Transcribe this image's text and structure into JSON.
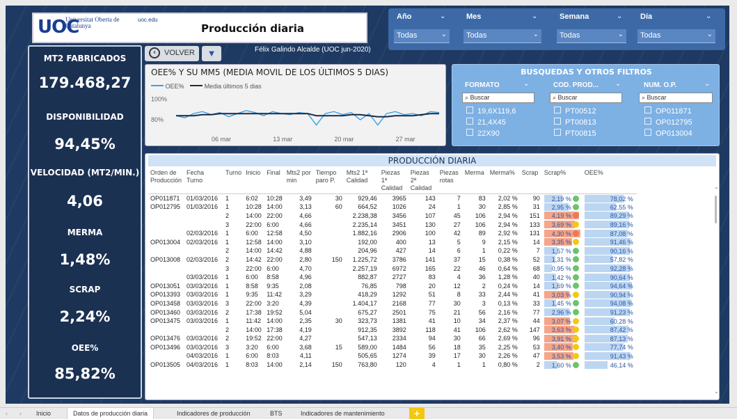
{
  "logo": {
    "text": "UOC",
    "university": "Universitat Oberta de Catalunya",
    "url": "uoc.edu"
  },
  "page_title": "Producción diaria",
  "slicers": [
    {
      "label": "Año",
      "value": "Todas"
    },
    {
      "label": "Mes",
      "value": "Todas"
    },
    {
      "label": "Semana",
      "value": "Todas"
    },
    {
      "label": "Día",
      "value": "Todas"
    }
  ],
  "kpis": [
    {
      "label": "MT2 FABRICADOS",
      "value": "179.468,27"
    },
    {
      "label": "DISPONIBILIDAD",
      "value": "94,45%"
    },
    {
      "label": "VELOCIDAD (MT2/MIN.)",
      "value": "4,06"
    },
    {
      "label": "MERMA",
      "value": "1,48%"
    },
    {
      "label": "SCRAP",
      "value": "2,24%"
    },
    {
      "label": "OEE%",
      "value": "85,82%"
    }
  ],
  "toolbar": {
    "back_label": "VOLVER",
    "author": "Félix Galindo Alcalde (UOC jun-2020)"
  },
  "oee_chart": {
    "title": "OEE% Y SU MM5 (MEDIA MOVIL DE LOS ÚLTIMOS 5 DIAS)",
    "legend": [
      "OEE%",
      "Media últimos 5 dias"
    ],
    "colors": {
      "oee": "#3aa0e8",
      "avg": "#1b2a44"
    },
    "y_ticks": [
      "100%",
      "80%"
    ],
    "x_ticks": [
      "06 mar",
      "13 mar",
      "20 mar",
      "27 mar"
    ]
  },
  "chart_data": {
    "type": "line",
    "x": [
      1,
      2,
      3,
      4,
      5,
      6,
      7,
      8,
      9,
      10,
      11,
      12,
      13,
      14,
      15,
      16,
      17,
      18,
      19,
      20,
      21,
      22,
      23,
      24,
      25,
      26,
      27,
      28,
      29,
      30,
      31
    ],
    "series": [
      {
        "name": "OEE%",
        "values": [
          84,
          82,
          86,
          88,
          85,
          87,
          83,
          86,
          89,
          87,
          84,
          88,
          86,
          85,
          87,
          86,
          75,
          86,
          88,
          85,
          87,
          80,
          86,
          75,
          86,
          88,
          85,
          86,
          84,
          88,
          87
        ]
      },
      {
        "name": "Media últimos 5 dias",
        "values": [
          84,
          84,
          84,
          85,
          85,
          86,
          86,
          86,
          86,
          86,
          86,
          86,
          86,
          86,
          86,
          86,
          84,
          84,
          84,
          84,
          85,
          85,
          84,
          83,
          83,
          84,
          84,
          84,
          85,
          86,
          86
        ]
      }
    ],
    "ylim": [
      70,
      105
    ],
    "xlabels": [
      "06 mar",
      "13 mar",
      "20 mar",
      "27 mar"
    ],
    "ylabels": [
      "100%",
      "80%"
    ]
  },
  "filters": {
    "title": "BUSQUEDAS Y OTROS FILTROS",
    "search_placeholder": "Buscar",
    "columns": [
      {
        "header": "FORMATO",
        "items": [
          "19,6X119,6",
          "21,4X45",
          "22X90"
        ]
      },
      {
        "header": "COD. PROD...",
        "items": [
          "PT00512",
          "PT00813",
          "PT00815"
        ]
      },
      {
        "header": "NUM. O.P.",
        "items": [
          "OP011871",
          "OP012795",
          "OP013004"
        ]
      }
    ]
  },
  "table": {
    "title": "PRODUCCIÓN DIARIA",
    "headers": [
      "Orden de Producción",
      "Fecha Turno",
      "Turno",
      "Inicio",
      "Final",
      "Mts2 por min",
      "Tiempo paro P.",
      "Mts2 1ª Calidad",
      "Piezas 1ª Calidad",
      "Piezas 2ª Calidad",
      "Piezas rotas",
      "Merma",
      "Merma%",
      "Scrap",
      "Scrap%",
      "OEE%"
    ],
    "rows": [
      [
        "OP011871",
        "01/03/2016",
        "1",
        "6:02",
        "10:28",
        "3,49",
        "30",
        "929,46",
        "3965",
        "143",
        "7",
        "83",
        "2,02 %",
        "90",
        "2,19 %",
        "78,02 %"
      ],
      [
        "OP012795",
        "01/03/2016",
        "1",
        "10:28",
        "14:00",
        "3,13",
        "60",
        "664,52",
        "1026",
        "24",
        "1",
        "30",
        "2,85 %",
        "31",
        "2,95 %",
        "62,55 %"
      ],
      [
        "",
        "",
        "2",
        "14:00",
        "22:00",
        "4,66",
        "",
        "2.238,38",
        "3456",
        "107",
        "45",
        "106",
        "2,94 %",
        "151",
        "4,19 %",
        "89,29 %"
      ],
      [
        "",
        "",
        "3",
        "22:00",
        "6:00",
        "4,66",
        "",
        "2.235,14",
        "3451",
        "130",
        "27",
        "106",
        "2,94 %",
        "133",
        "3,69 %",
        "89,16 %"
      ],
      [
        "",
        "02/03/2016",
        "1",
        "6:00",
        "12:58",
        "4,50",
        "",
        "1.882,16",
        "2906",
        "100",
        "42",
        "89",
        "2,92 %",
        "131",
        "4,30 %",
        "87,08 %"
      ],
      [
        "OP013004",
        "02/03/2016",
        "1",
        "12:58",
        "14:00",
        "3,10",
        "",
        "192,00",
        "400",
        "13",
        "5",
        "9",
        "2,15 %",
        "14",
        "3,35 %",
        "91,46 %"
      ],
      [
        "",
        "",
        "2",
        "14:00",
        "14:42",
        "4,88",
        "",
        "204,96",
        "427",
        "14",
        "6",
        "1",
        "0,22 %",
        "7",
        "1,57 %",
        "90,16 %"
      ],
      [
        "OP013008",
        "02/03/2016",
        "2",
        "14:42",
        "22:00",
        "2,80",
        "150",
        "1.225,72",
        "3786",
        "141",
        "37",
        "15",
        "0,38 %",
        "52",
        "1,31 %",
        "57,82 %"
      ],
      [
        "",
        "",
        "3",
        "22:00",
        "6:00",
        "4,70",
        "",
        "2.257,19",
        "6972",
        "165",
        "22",
        "46",
        "0,64 %",
        "68",
        "0,95 %",
        "92,28 %"
      ],
      [
        "",
        "03/03/2016",
        "1",
        "6:00",
        "8:58",
        "4,96",
        "",
        "882,87",
        "2727",
        "83",
        "4",
        "36",
        "1,28 %",
        "40",
        "1,42 %",
        "90,64 %"
      ],
      [
        "OP013051",
        "03/03/2016",
        "1",
        "8:58",
        "9:35",
        "2,08",
        "",
        "76,85",
        "798",
        "20",
        "12",
        "2",
        "0,24 %",
        "14",
        "1,69 %",
        "94,64 %"
      ],
      [
        "OP013393",
        "03/03/2016",
        "1",
        "9:35",
        "11:42",
        "3,29",
        "",
        "418,29",
        "1292",
        "51",
        "8",
        "33",
        "2,44 %",
        "41",
        "3,03 %",
        "90,94 %"
      ],
      [
        "OP013458",
        "03/03/2016",
        "3",
        "22:00",
        "3:20",
        "4,39",
        "",
        "1.404,17",
        "2168",
        "77",
        "30",
        "3",
        "0,13 %",
        "33",
        "1,45 %",
        "94,08 %"
      ],
      [
        "OP013460",
        "03/03/2016",
        "2",
        "17:38",
        "19:52",
        "5,04",
        "",
        "675,27",
        "2501",
        "75",
        "21",
        "56",
        "2,16 %",
        "77",
        "2,96 %",
        "91,23 %"
      ],
      [
        "OP013475",
        "03/03/2016",
        "1",
        "11:42",
        "14:00",
        "2,35",
        "30",
        "323,73",
        "1381",
        "41",
        "10",
        "34",
        "2,37 %",
        "44",
        "3,07 %",
        "60,28 %"
      ],
      [
        "",
        "",
        "2",
        "14:00",
        "17:38",
        "4,19",
        "",
        "912,35",
        "3892",
        "118",
        "41",
        "106",
        "2,62 %",
        "147",
        "3,63 %",
        "87,42 %"
      ],
      [
        "OP013476",
        "03/03/2016",
        "2",
        "19:52",
        "22:00",
        "4,27",
        "",
        "547,13",
        "2334",
        "94",
        "30",
        "66",
        "2,69 %",
        "96",
        "3,91 %",
        "87,13 %"
      ],
      [
        "OP013496",
        "03/03/2016",
        "3",
        "3:20",
        "6:00",
        "3,68",
        "15",
        "589,00",
        "1484",
        "56",
        "18",
        "35",
        "2,25 %",
        "53",
        "3,40 %",
        "77,74 %"
      ],
      [
        "",
        "04/03/2016",
        "1",
        "6:00",
        "8:03",
        "4,11",
        "",
        "505,65",
        "1274",
        "39",
        "17",
        "30",
        "2,26 %",
        "47",
        "3,53 %",
        "91,43 %"
      ],
      [
        "OP013505",
        "04/03/2016",
        "1",
        "8:03",
        "14:00",
        "2,14",
        "150",
        "763,80",
        "120",
        "4",
        "1",
        "1",
        "0,80 %",
        "2",
        "1,60 %",
        "46,14 %"
      ]
    ],
    "scrap_pct": [
      2.19,
      2.95,
      4.19,
      3.69,
      4.3,
      3.35,
      1.57,
      1.31,
      0.95,
      1.42,
      1.69,
      3.03,
      1.45,
      2.96,
      3.07,
      3.63,
      3.91,
      3.4,
      3.53,
      1.6
    ],
    "oee_pct": [
      78.02,
      62.55,
      89.29,
      89.16,
      87.08,
      91.46,
      90.16,
      57.82,
      92.28,
      90.64,
      94.64,
      90.94,
      94.08,
      91.23,
      60.28,
      87.42,
      87.13,
      77.74,
      91.43,
      46.14
    ]
  },
  "tabs": [
    "Inicio",
    "Datos de producción diaria",
    "Indicadores de producción",
    "BTS",
    "Indicadores de mantenimiento"
  ],
  "active_tab": "Datos de producción diaria",
  "tab_add": "+",
  "nav": {
    "prev": "‹",
    "next": "›"
  }
}
